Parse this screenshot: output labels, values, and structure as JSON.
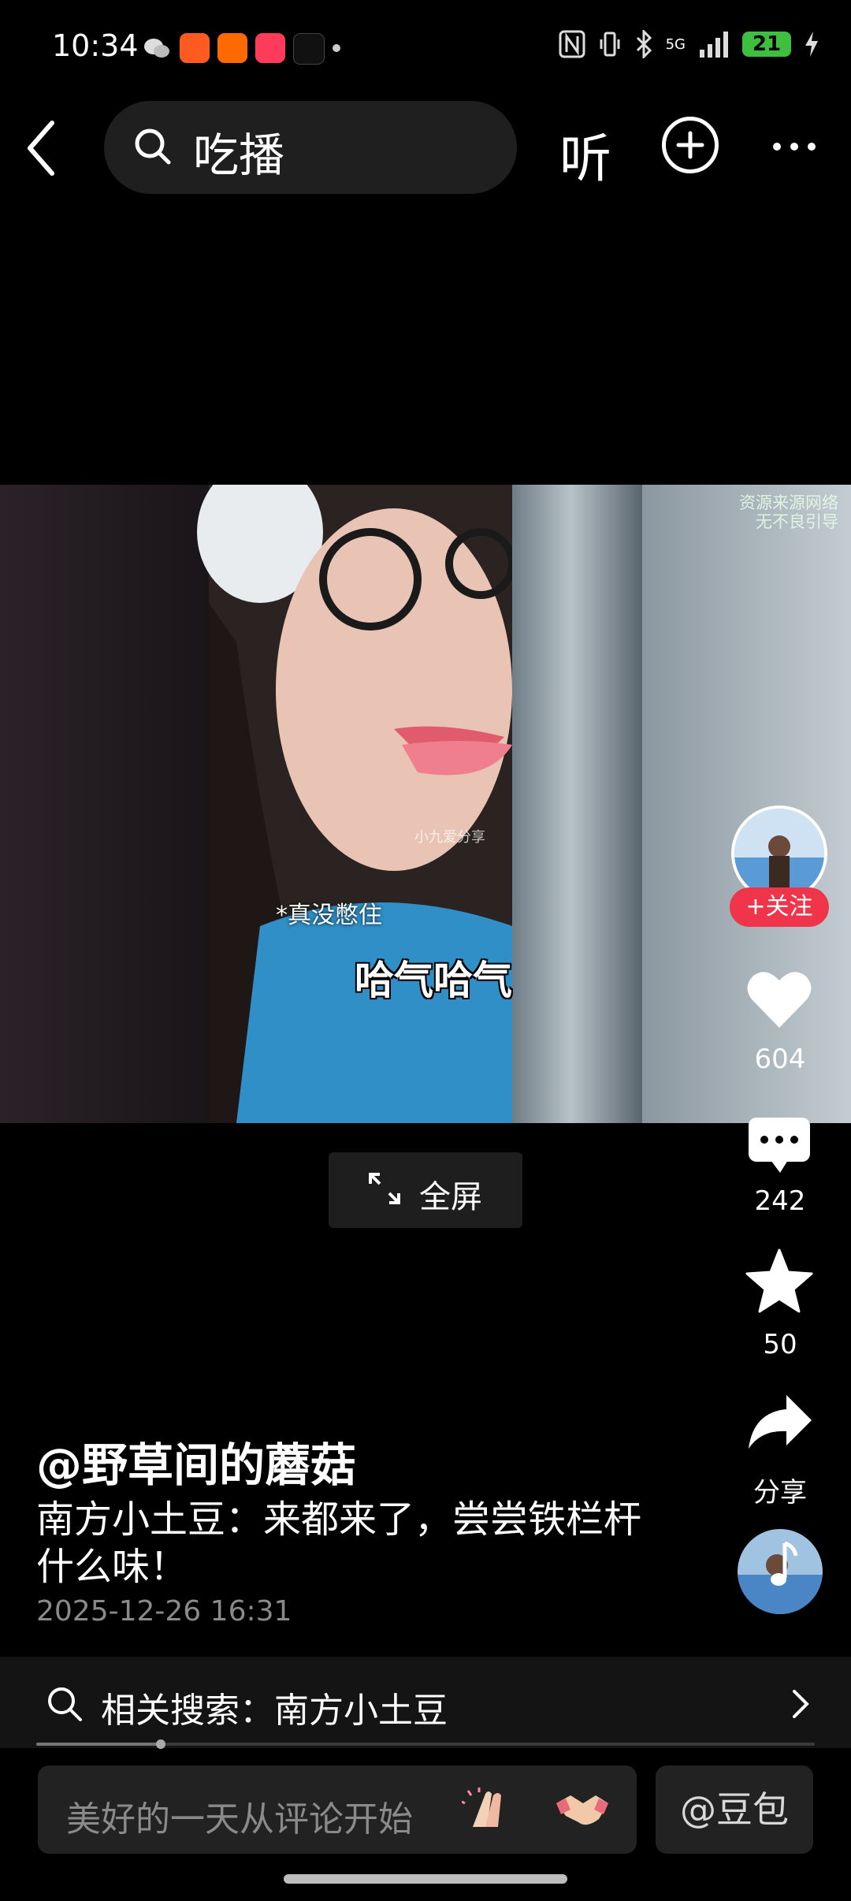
{
  "status_bar": {
    "time": "10:34",
    "network": "5G",
    "battery": "21"
  },
  "top_bar": {
    "search_text": "吃播",
    "listen_label": "听"
  },
  "video": {
    "subtitle_small": "*真没憋住",
    "subtitle_big": "哈气哈气",
    "watermark_small": "小九爱分享",
    "watermark_top_line1": "资源来源网络",
    "watermark_top_line2": "无不良引导",
    "fullscreen_label": "全屏"
  },
  "rail": {
    "follow_label": "+关注",
    "likes": "604",
    "comments": "242",
    "favorites": "50",
    "share_label": "分享"
  },
  "post": {
    "author": "@野草间的蘑菇",
    "description": "南方小土豆：来都来了，尝尝铁栏杆什么味！",
    "date": "2025-12-26 16:31"
  },
  "related": {
    "label": "相关搜索：南方小土豆"
  },
  "progress": {
    "fraction": 0.16
  },
  "comment_bar": {
    "placeholder": "美好的一天从评论开始",
    "doubao_label": "@豆包"
  },
  "colors": {
    "follow": "#f0344a",
    "battery": "#3fbf3f"
  }
}
